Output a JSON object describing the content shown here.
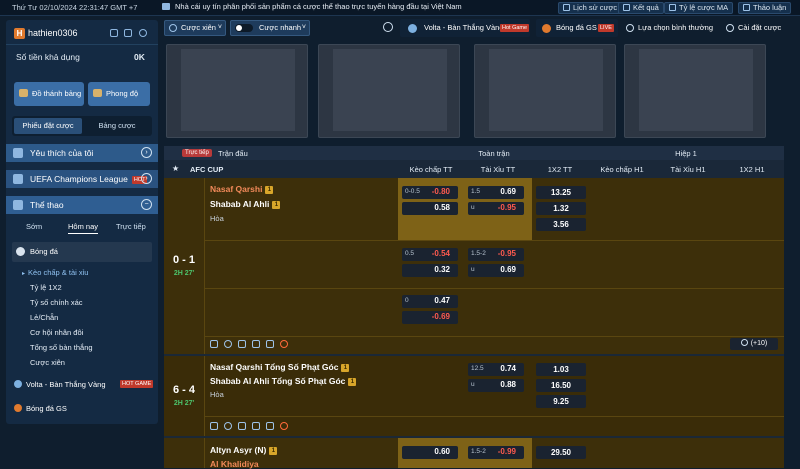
{
  "topbar": {
    "datetime": "Thứ Tư 02/10/2024 22:31:47 GMT +7",
    "marquee": "Nhà cái uy tín phân phối sản phẩm cá cược thể thao trực tuyến hàng đầu tại Việt Nam.",
    "buttons": [
      {
        "label": "Lịch sử cược",
        "icon": "history-icon"
      },
      {
        "label": "Kết quả",
        "icon": "results-icon"
      },
      {
        "label": "Tỷ lệ cược MA",
        "icon": "odds-icon"
      },
      {
        "label": "Thảo luận",
        "icon": "chat-icon"
      }
    ]
  },
  "sidebar": {
    "avatar_letter": "H",
    "username": "hathien0306",
    "balance_label": "Số tiền khả dụng",
    "balance_value": "0K",
    "btn_scoreboard": "Đồ thánh bảng",
    "btn_form": "Phong độ",
    "tab_slip": "Phiếu đặt cược",
    "tab_board": "Bảng cược",
    "favorites": "Yêu thích của tôi",
    "ucl": "UEFA Champions League",
    "hot": "HOT",
    "sports": "Thể thao",
    "subtabs": [
      "Sớm",
      "Hôm nay",
      "Trực tiếp"
    ],
    "sport_football": "Bóng đá",
    "menu": [
      "Kèo chấp & tài xỉu",
      "Tỷ lệ 1X2",
      "Tỷ số chính xác",
      "Lẻ/Chẵn",
      "Cơ hội nhân đôi",
      "Tổng số bàn thắng",
      "Cược xiên"
    ],
    "volta": "Volta - Bàn Thắng Vàng",
    "hot_game": "HOT GAME",
    "gs": "Bóng đá GS"
  },
  "mainbar": {
    "cuoc_xien": "Cược xiên",
    "cuoc_nhanh": "Cược nhanh",
    "volta": "Volta - Bàn Thắng Vàng",
    "hot_game": "Hot Game",
    "bong_da_gs": "Bóng đá GS",
    "live": "LIVE",
    "lua_chon": "Lựa chọn bình thường",
    "cai_dat": "Cài đặt cược"
  },
  "table": {
    "live_tag": "Trực tiếp",
    "col_match": "Trận đấu",
    "group_full": "Toàn trận",
    "group_h1": "Hiệp 1",
    "league": "AFC CUP",
    "cols": [
      "Kèo chấp TT",
      "Tài Xỉu TT",
      "1X2 TT",
      "Kèo chấp H1",
      "Tài Xỉu H1",
      "1X2 H1"
    ],
    "more": "(+10)",
    "match1": {
      "score": "0 - 1",
      "time": "2H 27'",
      "home": "Nasaf Qarshi",
      "away": "Shabab Al Ahli",
      "draw": "Hòa",
      "rows": [
        {
          "h_hdp": "0-0.5",
          "hdp1": "-0.80",
          "hdp2": "0.58",
          "h_ou": "1.5",
          "ou1": "0.69",
          "h_ou2": "u",
          "ou2": "-0.95",
          "x1": "13.25",
          "x2": "1.32",
          "x3": "3.56"
        },
        {
          "h_hdp": "0.5",
          "hdp1": "-0.54",
          "hdp2": "0.32",
          "h_ou": "1.5-2",
          "ou1": "-0.95",
          "h_ou2": "u",
          "ou2": "0.69"
        },
        {
          "h_hdp": "0",
          "hdp1": "0.47",
          "hdp2": "-0.69"
        }
      ]
    },
    "match2": {
      "score": "6 - 4",
      "time": "2H 27'",
      "home": "Nasaf Qarshi Tổng Số Phạt Góc",
      "away": "Shabab Al Ahli Tổng Số Phạt Góc",
      "draw": "Hòa",
      "h_ou": "12.5",
      "ou1": "0.74",
      "h_ou2": "u",
      "ou2": "0.88",
      "x1": "1.03",
      "x2": "16.50",
      "x3": "9.25"
    },
    "match3": {
      "home": "Altyn Asyr (N)",
      "away": "Al Khalidiya",
      "hdp1": "0.60",
      "h_ou": "1.5-2",
      "ou1": "-0.99",
      "x1": "29.50"
    }
  },
  "colors": {
    "accent": "#2d5a8a",
    "favorite": "#f28a5a",
    "negative": "#ff5a4e",
    "live_time": "#4cc36b"
  }
}
